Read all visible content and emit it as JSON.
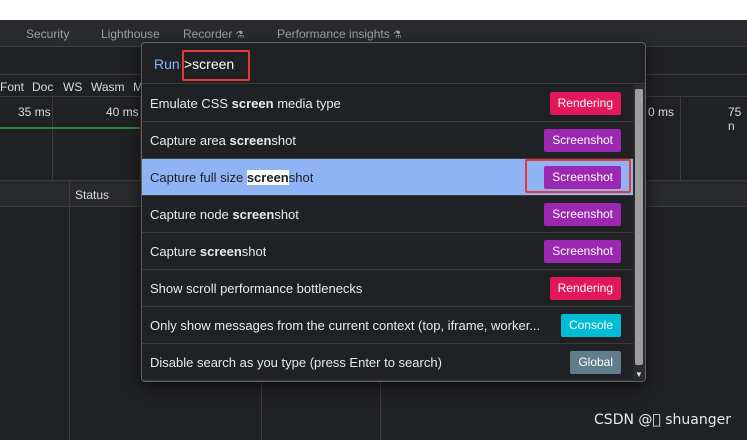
{
  "tabs": [
    "Security",
    "Lighthouse",
    "Recorder",
    "Performance insights"
  ],
  "filters": [
    "Font",
    "Doc",
    "WS",
    "Wasm",
    "M"
  ],
  "timeline_ticks": [
    "35 ms",
    "40 ms",
    "0 ms",
    "75 n"
  ],
  "table_headers": [
    "Status"
  ],
  "palette": {
    "prefix": "Run",
    "query": ">screen",
    "items": [
      {
        "label": "Emulate CSS screen media type",
        "badge": "Rendering",
        "badge_color": "#e2185a"
      },
      {
        "label": "Capture area screenshot",
        "badge": "Screenshot",
        "badge_color": "#9c27b0"
      },
      {
        "label": "Capture full size screenshot",
        "badge": "Screenshot",
        "badge_color": "#9c27b0",
        "selected": true
      },
      {
        "label": "Capture node screenshot",
        "badge": "Screenshot",
        "badge_color": "#9c27b0"
      },
      {
        "label": "Capture screenshot",
        "badge": "Screenshot",
        "badge_color": "#9c27b0"
      },
      {
        "label": "Show scroll performance bottlenecks",
        "badge": "Rendering",
        "badge_color": "#e2185a"
      },
      {
        "label": "Only show messages from the current context (top, iframe, worker...",
        "badge": "Console",
        "badge_color": "#00bcd4"
      },
      {
        "label": "Disable search as you type (press Enter to search)",
        "badge": "Global",
        "badge_color": "#607d8b"
      }
    ]
  },
  "watermark": "CSDN @\u0000 shuanger"
}
